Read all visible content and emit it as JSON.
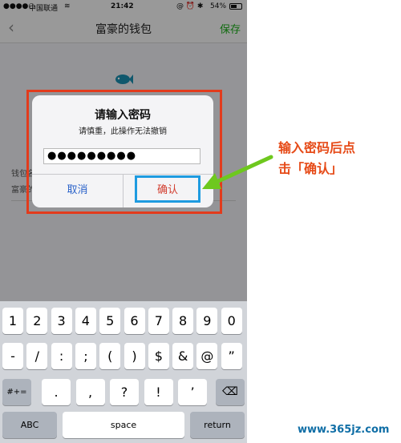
{
  "status_bar": {
    "carrier": "中国联通",
    "time": "21:42",
    "battery": "54%"
  },
  "nav": {
    "back_glyph": "‹",
    "title": "富豪的钱包",
    "save": "保存"
  },
  "form": {
    "label": "钱包名",
    "value": "富豪的"
  },
  "dialog": {
    "title": "请输入密码",
    "subtitle": "请慎重，此操作无法撤销",
    "password_value": "●●●●●●●●●",
    "cancel": "取消",
    "confirm": "确认"
  },
  "keyboard": {
    "row1": [
      "1",
      "2",
      "3",
      "4",
      "5",
      "6",
      "7",
      "8",
      "9",
      "0"
    ],
    "row2": [
      "-",
      "/",
      ":",
      ";",
      "(",
      ")",
      "$",
      "&",
      "@",
      "”"
    ],
    "row3_left": "#+=",
    "row3": [
      ".",
      ",",
      "?",
      "!",
      "’"
    ],
    "abc": "ABC",
    "space": "space",
    "return": "return"
  },
  "annotation": {
    "line1": "输入密码后点",
    "line2": "击「确认」"
  },
  "watermark": "www.365jz.com",
  "colors": {
    "highlight_red": "#e23b1c",
    "confirm_frame": "#1e9be0",
    "arrow": "#6ec81e",
    "save_green": "#1aad19"
  }
}
